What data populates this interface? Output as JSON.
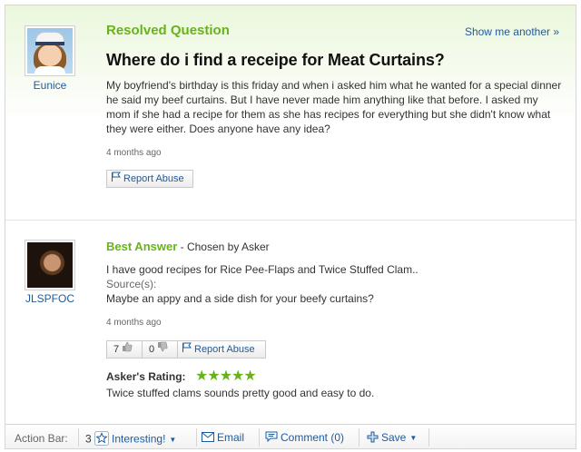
{
  "question": {
    "status_label": "Resolved Question",
    "show_another_link": "Show me another »",
    "asker_name": "Eunice",
    "title": "Where do i find a receipe for Meat Curtains?",
    "body": "My boyfriend's birthday is this friday and when i asked him what he wanted for a special dinner he said my beef curtains. But I have never made him anything like that before. I asked my mom if she had a recipe for them as she has recipes for everything but she didn't know what they were either. Does anyone have any idea?",
    "time_ago": "4 months ago",
    "report_abuse_label": "Report Abuse"
  },
  "answer": {
    "best_answer_label": "Best Answer",
    "chosen_by": " - Chosen by Asker",
    "answerer_name": "JLSPFOC",
    "body": "I have good recipes for Rice Pee-Flaps and Twice Stuffed Clam..",
    "sources_label": "Source(s):",
    "source_text": "Maybe an appy and a side dish for your beefy curtains?",
    "time_ago": "4 months ago",
    "thumbs_up_count": "7",
    "thumbs_down_count": "0",
    "report_abuse_label": "Report Abuse",
    "rating_label": "Asker's Rating:",
    "rating_stars": "★★★★★",
    "rating_stars_value": 5,
    "rating_comment": "Twice stuffed clams sounds pretty good and easy to do."
  },
  "action_bar": {
    "label": "Action Bar:",
    "interesting_count": "3",
    "interesting_label": "Interesting!",
    "email_label": "Email",
    "comment_label": "Comment (0)",
    "save_label": "Save"
  },
  "icons": {
    "flag": "flag-icon",
    "thumbs_up": "thumbs-up-icon",
    "thumbs_down": "thumbs-down-icon",
    "star": "star-icon",
    "email": "envelope-icon",
    "comment": "comment-bubble-icon",
    "save": "plus-icon",
    "dropdown": "caret-down-icon"
  },
  "colors": {
    "accent_green": "#68b31a",
    "link_blue": "#1d5a9e",
    "text": "#333333"
  }
}
